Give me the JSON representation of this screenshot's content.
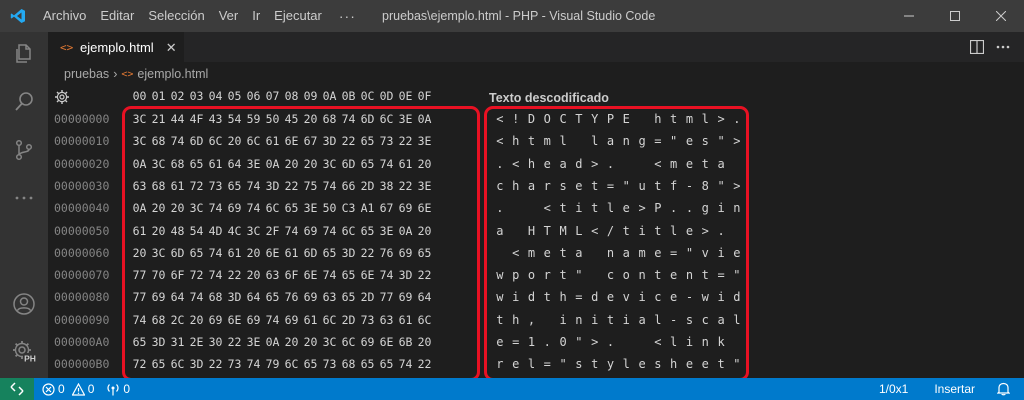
{
  "window": {
    "title": "pruebas\\ejemplo.html - PHP - Visual Studio Code"
  },
  "menu": [
    "Archivo",
    "Editar",
    "Selección",
    "Ver",
    "Ir",
    "Ejecutar"
  ],
  "menu_more": "···",
  "tab": {
    "label": "ejemplo.html",
    "icon_text": "<>",
    "close": "✕"
  },
  "breadcrumb": {
    "folder": "pruebas",
    "separator": "›",
    "file": "ejemplo.html",
    "file_icon": "<>"
  },
  "hex": {
    "columns": [
      "00",
      "01",
      "02",
      "03",
      "04",
      "05",
      "06",
      "07",
      "08",
      "09",
      "0A",
      "0B",
      "0C",
      "0D",
      "0E",
      "0F"
    ],
    "decoded_title": "Texto descodificado",
    "rows": [
      {
        "offset": "00000000",
        "bytes": [
          "3C",
          "21",
          "44",
          "4F",
          "43",
          "54",
          "59",
          "50",
          "45",
          "20",
          "68",
          "74",
          "6D",
          "6C",
          "3E",
          "0A"
        ],
        "decoded": [
          "<",
          "!",
          "D",
          "O",
          "C",
          "T",
          "Y",
          "P",
          "E",
          " ",
          "h",
          "t",
          "m",
          "l",
          ">",
          "."
        ]
      },
      {
        "offset": "00000010",
        "bytes": [
          "3C",
          "68",
          "74",
          "6D",
          "6C",
          "20",
          "6C",
          "61",
          "6E",
          "67",
          "3D",
          "22",
          "65",
          "73",
          "22",
          "3E"
        ],
        "decoded": [
          "<",
          "h",
          "t",
          "m",
          "l",
          " ",
          "l",
          "a",
          "n",
          "g",
          "=",
          "\"",
          "e",
          "s",
          "\"",
          ">"
        ]
      },
      {
        "offset": "00000020",
        "bytes": [
          "0A",
          "3C",
          "68",
          "65",
          "61",
          "64",
          "3E",
          "0A",
          "20",
          "20",
          "3C",
          "6D",
          "65",
          "74",
          "61",
          "20"
        ],
        "decoded": [
          ".",
          "<",
          "h",
          "e",
          "a",
          "d",
          ">",
          ".",
          " ",
          " ",
          "<",
          "m",
          "e",
          "t",
          "a",
          " "
        ]
      },
      {
        "offset": "00000030",
        "bytes": [
          "63",
          "68",
          "61",
          "72",
          "73",
          "65",
          "74",
          "3D",
          "22",
          "75",
          "74",
          "66",
          "2D",
          "38",
          "22",
          "3E"
        ],
        "decoded": [
          "c",
          "h",
          "a",
          "r",
          "s",
          "e",
          "t",
          "=",
          "\"",
          "u",
          "t",
          "f",
          "-",
          "8",
          "\"",
          ">"
        ]
      },
      {
        "offset": "00000040",
        "bytes": [
          "0A",
          "20",
          "20",
          "3C",
          "74",
          "69",
          "74",
          "6C",
          "65",
          "3E",
          "50",
          "C3",
          "A1",
          "67",
          "69",
          "6E"
        ],
        "decoded": [
          ".",
          " ",
          " ",
          "<",
          "t",
          "i",
          "t",
          "l",
          "e",
          ">",
          "P",
          ".",
          ".",
          "g",
          "i",
          "n"
        ]
      },
      {
        "offset": "00000050",
        "bytes": [
          "61",
          "20",
          "48",
          "54",
          "4D",
          "4C",
          "3C",
          "2F",
          "74",
          "69",
          "74",
          "6C",
          "65",
          "3E",
          "0A",
          "20"
        ],
        "decoded": [
          "a",
          " ",
          "H",
          "T",
          "M",
          "L",
          "<",
          "/",
          "t",
          "i",
          "t",
          "l",
          "e",
          ">",
          ".",
          " "
        ]
      },
      {
        "offset": "00000060",
        "bytes": [
          "20",
          "3C",
          "6D",
          "65",
          "74",
          "61",
          "20",
          "6E",
          "61",
          "6D",
          "65",
          "3D",
          "22",
          "76",
          "69",
          "65"
        ],
        "decoded": [
          " ",
          "<",
          "m",
          "e",
          "t",
          "a",
          " ",
          "n",
          "a",
          "m",
          "e",
          "=",
          "\"",
          "v",
          "i",
          "e"
        ]
      },
      {
        "offset": "00000070",
        "bytes": [
          "77",
          "70",
          "6F",
          "72",
          "74",
          "22",
          "20",
          "63",
          "6F",
          "6E",
          "74",
          "65",
          "6E",
          "74",
          "3D",
          "22"
        ],
        "decoded": [
          "w",
          "p",
          "o",
          "r",
          "t",
          "\"",
          " ",
          "c",
          "o",
          "n",
          "t",
          "e",
          "n",
          "t",
          "=",
          "\""
        ]
      },
      {
        "offset": "00000080",
        "bytes": [
          "77",
          "69",
          "64",
          "74",
          "68",
          "3D",
          "64",
          "65",
          "76",
          "69",
          "63",
          "65",
          "2D",
          "77",
          "69",
          "64"
        ],
        "decoded": [
          "w",
          "i",
          "d",
          "t",
          "h",
          "=",
          "d",
          "e",
          "v",
          "i",
          "c",
          "e",
          "-",
          "w",
          "i",
          "d"
        ]
      },
      {
        "offset": "00000090",
        "bytes": [
          "74",
          "68",
          "2C",
          "20",
          "69",
          "6E",
          "69",
          "74",
          "69",
          "61",
          "6C",
          "2D",
          "73",
          "63",
          "61",
          "6C"
        ],
        "decoded": [
          "t",
          "h",
          ",",
          " ",
          "i",
          "n",
          "i",
          "t",
          "i",
          "a",
          "l",
          "-",
          "s",
          "c",
          "a",
          "l"
        ]
      },
      {
        "offset": "000000A0",
        "bytes": [
          "65",
          "3D",
          "31",
          "2E",
          "30",
          "22",
          "3E",
          "0A",
          "20",
          "20",
          "3C",
          "6C",
          "69",
          "6E",
          "6B",
          "20"
        ],
        "decoded": [
          "e",
          "=",
          "1",
          ".",
          "0",
          "\"",
          ">",
          ".",
          " ",
          " ",
          "<",
          "l",
          "i",
          "n",
          "k",
          " "
        ]
      },
      {
        "offset": "000000B0",
        "bytes": [
          "72",
          "65",
          "6C",
          "3D",
          "22",
          "73",
          "74",
          "79",
          "6C",
          "65",
          "73",
          "68",
          "65",
          "65",
          "74",
          "22"
        ],
        "decoded": [
          "r",
          "e",
          "l",
          "=",
          "\"",
          "s",
          "t",
          "y",
          "l",
          "e",
          "s",
          "h",
          "e",
          "e",
          "t",
          "\""
        ]
      }
    ]
  },
  "status": {
    "errors": "0",
    "warnings": "0",
    "info": "0",
    "selection": "1/0x1",
    "mode": "Insertar"
  },
  "colors": {
    "statusbar": "#007acc",
    "highlight_box": "#e81123",
    "php_badge": "PH"
  }
}
